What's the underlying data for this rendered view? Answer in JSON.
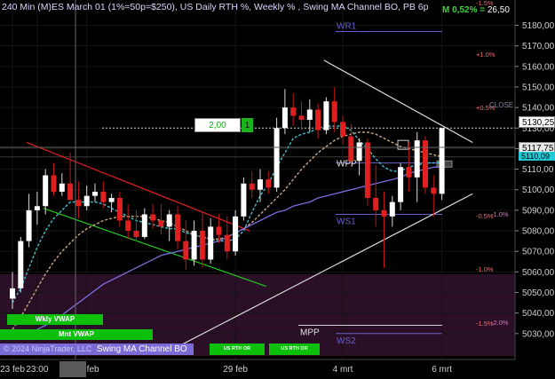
{
  "title": "240 Min (M)ES March 01 (1%=50p=$250), US Daily RTH %, Weekly % , Swing MA Channel BO, PB 6p",
  "position": {
    "label": "M 0,52% = ",
    "value": "26,50"
  },
  "order_qty": "2,00",
  "order_button": "1",
  "price_tags": {
    "close_price": "5130,25",
    "current_price": "5117,75",
    "cyan_price": "5110,09"
  },
  "labels": {
    "weekly_vwap": "Wkly VWAP",
    "monthly_vwap": "Mnt VWAP",
    "swing_ma": "Swing MA Channel BO",
    "copyright": "© 2024 NinjaTrader, LLC",
    "rth_1": "US RTH OR",
    "rth_2": "US RTH OR",
    "close_label": "CLOSE"
  },
  "colors": {
    "background": "#000000",
    "bull_candle": "#ffffff",
    "bear_candle": "#e02020",
    "teal_ma": "#3cc3d0",
    "tan_ma": "#c9a982",
    "purple_ma": "#7b6ee0",
    "pivot_lines": "#6a5fc8",
    "zone_fill": "#2a0f26"
  },
  "chart_data": {
    "type": "candlestick",
    "y_axis": {
      "range": [
        5023,
        5188
      ],
      "ticks": [
        5030,
        5040,
        5050,
        5060,
        5070,
        5080,
        5090,
        5100,
        5110,
        5120,
        5130,
        5140,
        5150,
        5160,
        5170,
        5180
      ],
      "tick_labels": [
        "5030,00",
        "5040,00",
        "5050,00",
        "5060,00",
        "5070,00",
        "5080,00",
        "5090,00",
        "5100,00",
        "5110,00",
        "5120,00",
        "5130,00",
        "5140,00",
        "5150,00",
        "5160,00",
        "5170,00",
        "5180,00"
      ]
    },
    "x_axis": {
      "labels": [
        {
          "text": "23 feb",
          "bar": 0
        },
        {
          "text": "23:00",
          "bar": 3
        },
        {
          "text": "27 feb",
          "bar": 9
        },
        {
          "text": "29 feb",
          "bar": 27
        },
        {
          "text": "4 mrt",
          "bar": 40
        },
        {
          "text": "6 mrt",
          "bar": 52
        }
      ]
    },
    "candles": [
      {
        "o": 5047,
        "h": 5060,
        "l": 5042,
        "c": 5052
      },
      {
        "o": 5052,
        "h": 5077,
        "l": 5050,
        "c": 5075
      },
      {
        "o": 5075,
        "h": 5098,
        "l": 5072,
        "c": 5090
      },
      {
        "o": 5090,
        "h": 5099,
        "l": 5083,
        "c": 5092
      },
      {
        "o": 5092,
        "h": 5110,
        "l": 5088,
        "c": 5107
      },
      {
        "o": 5107,
        "h": 5113,
        "l": 5097,
        "c": 5099
      },
      {
        "o": 5099,
        "h": 5108,
        "l": 5097,
        "c": 5103
      },
      {
        "o": 5103,
        "h": 5118,
        "l": 5100,
        "c": 5095
      },
      {
        "o": 5095,
        "h": 5104,
        "l": 5086,
        "c": 5092
      },
      {
        "o": 5092,
        "h": 5102,
        "l": 5090,
        "c": 5097
      },
      {
        "o": 5097,
        "h": 5103,
        "l": 5094,
        "c": 5099
      },
      {
        "o": 5099,
        "h": 5104,
        "l": 5091,
        "c": 5094
      },
      {
        "o": 5094,
        "h": 5098,
        "l": 5089,
        "c": 5096
      },
      {
        "o": 5096,
        "h": 5099,
        "l": 5082,
        "c": 5085
      },
      {
        "o": 5085,
        "h": 5093,
        "l": 5076,
        "c": 5080
      },
      {
        "o": 5080,
        "h": 5090,
        "l": 5075,
        "c": 5077
      },
      {
        "o": 5077,
        "h": 5091,
        "l": 5076,
        "c": 5088
      },
      {
        "o": 5088,
        "h": 5093,
        "l": 5081,
        "c": 5085
      },
      {
        "o": 5085,
        "h": 5093,
        "l": 5078,
        "c": 5082
      },
      {
        "o": 5082,
        "h": 5090,
        "l": 5075,
        "c": 5088
      },
      {
        "o": 5088,
        "h": 5092,
        "l": 5071,
        "c": 5075
      },
      {
        "o": 5075,
        "h": 5085,
        "l": 5061,
        "c": 5066
      },
      {
        "o": 5066,
        "h": 5085,
        "l": 5063,
        "c": 5080
      },
      {
        "o": 5080,
        "h": 5089,
        "l": 5062,
        "c": 5066
      },
      {
        "o": 5066,
        "h": 5086,
        "l": 5064,
        "c": 5082
      },
      {
        "o": 5082,
        "h": 5088,
        "l": 5074,
        "c": 5078
      },
      {
        "o": 5078,
        "h": 5087,
        "l": 5066,
        "c": 5070
      },
      {
        "o": 5070,
        "h": 5090,
        "l": 5068,
        "c": 5087
      },
      {
        "o": 5087,
        "h": 5106,
        "l": 5085,
        "c": 5103
      },
      {
        "o": 5103,
        "h": 5109,
        "l": 5096,
        "c": 5100
      },
      {
        "o": 5100,
        "h": 5110,
        "l": 5094,
        "c": 5105
      },
      {
        "o": 5105,
        "h": 5109,
        "l": 5098,
        "c": 5101
      },
      {
        "o": 5101,
        "h": 5135,
        "l": 5099,
        "c": 5130
      },
      {
        "o": 5130,
        "h": 5149,
        "l": 5127,
        "c": 5140
      },
      {
        "o": 5140,
        "h": 5147,
        "l": 5131,
        "c": 5136
      },
      {
        "o": 5136,
        "h": 5143,
        "l": 5129,
        "c": 5134
      },
      {
        "o": 5134,
        "h": 5144,
        "l": 5128,
        "c": 5139
      },
      {
        "o": 5139,
        "h": 5142,
        "l": 5125,
        "c": 5129
      },
      {
        "o": 5129,
        "h": 5145,
        "l": 5127,
        "c": 5143
      },
      {
        "o": 5143,
        "h": 5150,
        "l": 5128,
        "c": 5133
      },
      {
        "o": 5133,
        "h": 5136,
        "l": 5122,
        "c": 5126
      },
      {
        "o": 5126,
        "h": 5132,
        "l": 5111,
        "c": 5114
      },
      {
        "o": 5114,
        "h": 5125,
        "l": 5107,
        "c": 5123
      },
      {
        "o": 5123,
        "h": 5125,
        "l": 5092,
        "c": 5096
      },
      {
        "o": 5096,
        "h": 5112,
        "l": 5082,
        "c": 5090
      },
      {
        "o": 5090,
        "h": 5099,
        "l": 5062,
        "c": 5087
      },
      {
        "o": 5087,
        "h": 5097,
        "l": 5082,
        "c": 5094
      },
      {
        "o": 5094,
        "h": 5113,
        "l": 5090,
        "c": 5111
      },
      {
        "o": 5111,
        "h": 5123,
        "l": 5099,
        "c": 5106
      },
      {
        "o": 5106,
        "h": 5128,
        "l": 5094,
        "c": 5124
      },
      {
        "o": 5124,
        "h": 5126,
        "l": 5098,
        "c": 5101
      },
      {
        "o": 5101,
        "h": 5107,
        "l": 5087,
        "c": 5098
      },
      {
        "o": 5098,
        "h": 5130,
        "l": 5095,
        "c": 5130
      }
    ],
    "moving_averages": [
      {
        "name": "teal",
        "values": [
          5045,
          5052,
          5062,
          5072,
          5080,
          5086,
          5090,
          5094,
          5094,
          5094,
          5094,
          5093,
          5091,
          5089,
          5087,
          5085,
          5084,
          5083,
          5082,
          5081,
          5081,
          5079,
          5078,
          5077,
          5076,
          5075,
          5075,
          5076,
          5080,
          5089,
          5097,
          5103,
          5111,
          5118,
          5125,
          5127,
          5128,
          5130,
          5131,
          5131,
          5131,
          5129,
          5124,
          5120,
          5115,
          5111,
          5109,
          5109,
          5111,
          5112,
          5113,
          5113,
          5113
        ]
      },
      {
        "name": "tan",
        "values": [
          5032,
          5038,
          5045,
          5052,
          5059,
          5065,
          5070,
          5074,
          5078,
          5081,
          5083,
          5085,
          5086,
          5087,
          5087,
          5087,
          5087,
          5086,
          5085,
          5084,
          5082,
          5080,
          5078,
          5077,
          5076,
          5076,
          5077,
          5079,
          5081,
          5084,
          5088,
          5092,
          5096,
          5100,
          5105,
          5110,
          5114,
          5118,
          5121,
          5124,
          5126,
          5127,
          5128,
          5128,
          5127,
          5125,
          5123,
          5121,
          5120,
          5119,
          5118,
          5117,
          5116
        ]
      },
      {
        "name": "purple",
        "values": [
          5028,
          5029,
          5030,
          5032,
          5034,
          5036,
          5039,
          5042,
          5045,
          5048,
          5051,
          5054,
          5056,
          5058,
          5060,
          5062,
          5064,
          5066,
          5068,
          5069,
          5070,
          5071,
          5072,
          5073,
          5074,
          5075,
          5077,
          5079,
          5081,
          5083,
          5085,
          5087,
          5089,
          5090,
          5092,
          5093,
          5094,
          5096,
          5097,
          5098,
          5099,
          5100,
          5101,
          5102,
          5103,
          5104,
          5105,
          5106,
          5108,
          5109,
          5110,
          5111,
          5111
        ]
      }
    ],
    "pivots": [
      {
        "label": "WR1",
        "price": 5177
      },
      {
        "label": "WPP",
        "price": 5113
      },
      {
        "label": "WS1",
        "price": 5088
      },
      {
        "label": "MPP",
        "price": 5034
      },
      {
        "label": "WS2",
        "price": 5030
      }
    ],
    "percent_levels": [
      {
        "label": "+1.0%",
        "price": 5160
      },
      {
        "label": "+0.5%",
        "price": 5137
      },
      {
        "label": "-0.5%",
        "price": 5088
      },
      {
        "label": "-1.0%",
        "price": 5062
      },
      {
        "label": "-1.5%",
        "price": 5036
      },
      {
        "label": "-1.0%",
        "price": 5089
      },
      {
        "label": "-2.0%",
        "price": 5036
      },
      {
        "label": "-1.5%",
        "price": 5188
      }
    ],
    "reference_lines": [
      {
        "name": "close-line",
        "price": 5130
      },
      {
        "name": "current-price-line",
        "price": 5118
      }
    ],
    "trend_lines": [
      {
        "name": "red",
        "from": {
          "bar": 0,
          "price": 5123
        },
        "to": {
          "bar": 27,
          "price": 5080
        },
        "color": "#e02020"
      },
      {
        "name": "green",
        "from": {
          "bar": 2,
          "price": 5091
        },
        "to": {
          "bar": 29,
          "price": 5053
        },
        "color": "#22cc22"
      },
      {
        "name": "white-upper",
        "from": {
          "bar": 36,
          "price": 5163
        },
        "to": {
          "bar": 54,
          "price": 5123
        },
        "color": "#dcdcdc"
      },
      {
        "name": "white-lower",
        "from": {
          "bar": 18,
          "price": 5023
        },
        "to": {
          "bar": 54,
          "price": 5098
        },
        "color": "#dcdcdc"
      }
    ]
  }
}
